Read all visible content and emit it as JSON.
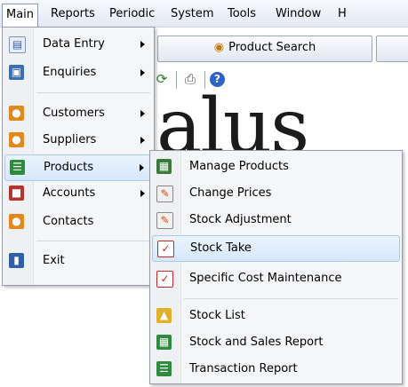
{
  "menubar": {
    "items": [
      "Main",
      "Reports",
      "Periodic",
      "System",
      "Tools",
      "Window",
      "H"
    ]
  },
  "toolbar": {
    "product_search_label": "Product Search"
  },
  "logo": {
    "text": "alus"
  },
  "main_menu": {
    "items": [
      {
        "label": "Data Entry",
        "icon": "data-entry-icon",
        "submenu": true
      },
      {
        "label": "Enquiries",
        "icon": "enquiries-icon",
        "submenu": true
      },
      {
        "label": "Customers",
        "icon": "customers-icon",
        "submenu": true
      },
      {
        "label": "Suppliers",
        "icon": "suppliers-icon",
        "submenu": true
      },
      {
        "label": "Products",
        "icon": "products-icon",
        "submenu": true
      },
      {
        "label": "Accounts",
        "icon": "accounts-icon",
        "submenu": true
      },
      {
        "label": "Contacts",
        "icon": "contacts-icon",
        "submenu": false
      },
      {
        "label": "Exit",
        "icon": "exit-icon",
        "submenu": false
      }
    ]
  },
  "products_menu": {
    "items": [
      {
        "label": "Manage Products",
        "icon": "manage-products-icon"
      },
      {
        "label": "Change Prices",
        "icon": "change-prices-icon"
      },
      {
        "label": "Stock Adjustment",
        "icon": "stock-adjustment-icon"
      },
      {
        "label": "Stock Take",
        "icon": "stock-take-icon"
      },
      {
        "label": "Specific Cost Maintenance",
        "icon": "specific-cost-icon"
      },
      {
        "label": "Stock List",
        "icon": "stock-list-icon"
      },
      {
        "label": "Stock and Sales Report",
        "icon": "stock-sales-report-icon"
      },
      {
        "label": "Transaction Report",
        "icon": "transaction-report-icon"
      }
    ]
  },
  "colors": {
    "highlight_border": "#a9c9ef",
    "highlight_fill": "#d6e8fb",
    "menu_bg": "#f5f6f8"
  }
}
